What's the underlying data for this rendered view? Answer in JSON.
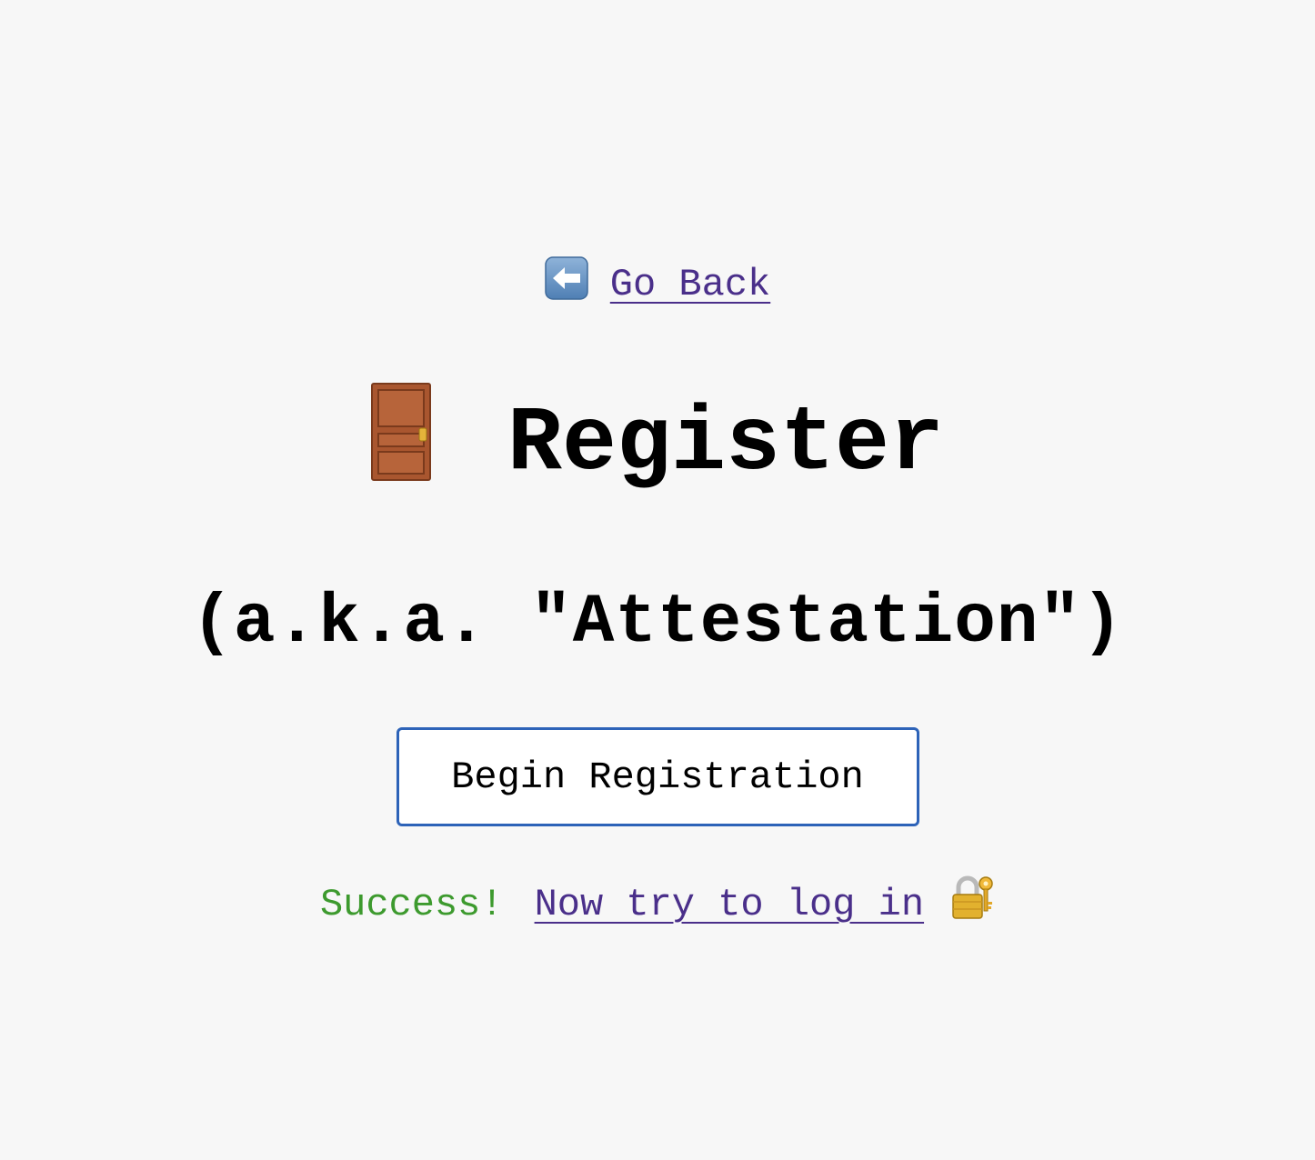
{
  "nav": {
    "back_icon": "left-arrow-icon",
    "back_label": "Go Back"
  },
  "header": {
    "icon": "door-icon",
    "title": "Register",
    "subtitle": "(a.k.a. \"Attestation\")"
  },
  "actions": {
    "begin_label": "Begin Registration"
  },
  "status": {
    "success_text": "Success!",
    "login_link_label": "Now try to log in",
    "login_icon": "locked-with-key-icon"
  },
  "colors": {
    "background": "#f7f7f7",
    "link": "#4a2f8a",
    "success": "#3d9a2e",
    "button_border": "#2d63b8"
  }
}
